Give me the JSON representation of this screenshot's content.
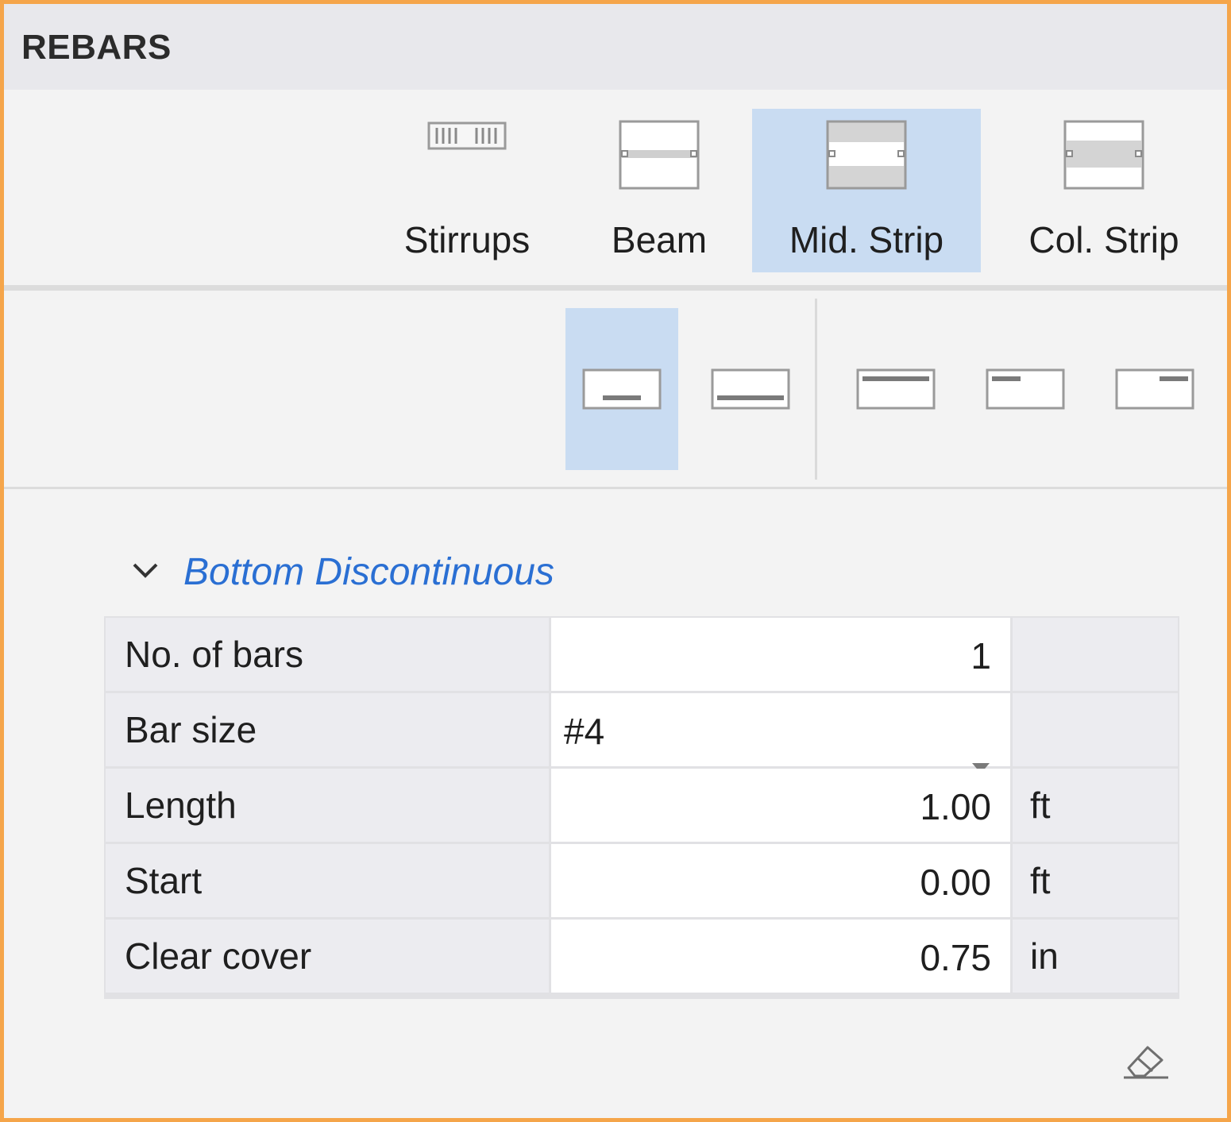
{
  "panel": {
    "title": "REBARS"
  },
  "categories": [
    {
      "label": "Stirrups",
      "icon": "stirrups-icon",
      "selected": false
    },
    {
      "label": "Beam",
      "icon": "beam-icon",
      "selected": false
    },
    {
      "label": "Mid. Strip",
      "icon": "mid-strip-icon",
      "selected": true
    },
    {
      "label": "Col. Strip",
      "icon": "col-strip-icon",
      "selected": false
    }
  ],
  "subtypes": [
    {
      "icon": "bottom-discontinuous-icon",
      "selected": true
    },
    {
      "icon": "bottom-continuous-icon",
      "selected": false
    },
    {
      "icon": "top-continuous-icon",
      "selected": false
    },
    {
      "icon": "top-left-icon",
      "selected": false
    },
    {
      "icon": "top-right-icon",
      "selected": false
    }
  ],
  "section": {
    "title": "Bottom Discontinuous",
    "expanded": true,
    "rows": [
      {
        "label": "No. of bars",
        "value": "1",
        "unit": ""
      },
      {
        "label": "Bar size",
        "value": "#4",
        "unit": ""
      },
      {
        "label": "Length",
        "value": "1.00",
        "unit": "ft"
      },
      {
        "label": "Start",
        "value": "0.00",
        "unit": "ft"
      },
      {
        "label": "Clear cover",
        "value": "0.75",
        "unit": "in"
      }
    ]
  },
  "colors": {
    "accent": "#2a6fd3",
    "selected": "#c9dcf2",
    "border": "#f5a54a"
  }
}
